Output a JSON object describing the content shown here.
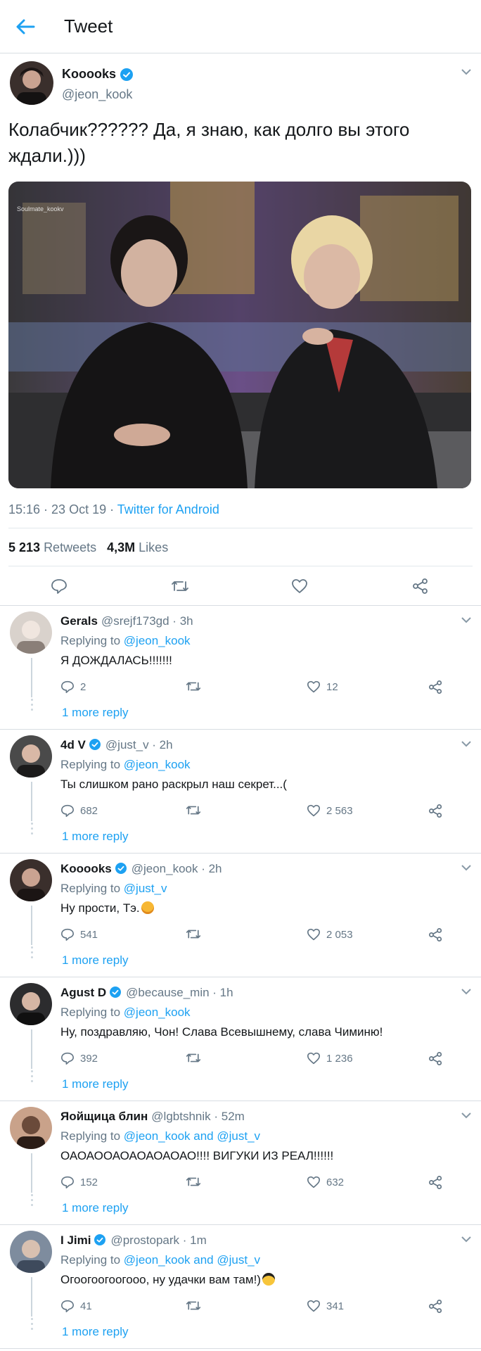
{
  "header": {
    "title": "Tweet"
  },
  "tweet": {
    "name": "Kooooks",
    "handle": "@jeon_kook",
    "text": "Колабчик?????? Да, я знаю, как долго вы этого ждали.)))",
    "timestamp": "15:16 · 23 Oct 19 · ",
    "source": "Twitter for Android",
    "retweets_count": "5 213",
    "retweets_label": "Retweets",
    "likes_count": "4,3M",
    "likes_label": "Likes"
  },
  "replies": [
    {
      "name": "Gerals",
      "verified": false,
      "handle": "@srejf173gd · 3h",
      "replying_prefix": "Replying to ",
      "replying_to": "@jeon_kook",
      "text": "Я ДОЖДАЛАСЬ!!!!!!!",
      "replies": "2",
      "retweets": "",
      "likes": "12",
      "more": "1 more reply"
    },
    {
      "name": "4d V",
      "verified": true,
      "handle": "@just_v · 2h",
      "replying_prefix": "Replying to ",
      "replying_to": "@jeon_kook",
      "text": "Ты слишком рано раскрыл наш секрет...(",
      "replies": "682",
      "retweets": "",
      "likes": "2 563",
      "more": "1 more reply"
    },
    {
      "name": "Kooooks",
      "verified": true,
      "handle": "@jeon_kook · 2h",
      "replying_prefix": "Replying to ",
      "replying_to": "@just_v",
      "text": "Ну прости, Тэ.",
      "replies": "541",
      "retweets": "",
      "likes": "2 053",
      "more": "1 more reply"
    },
    {
      "name": "Agust D",
      "verified": true,
      "handle": "@because_min · 1h",
      "replying_prefix": "Replying to ",
      "replying_to": "@jeon_kook",
      "text": "Ну, поздравляю, Чон! Слава Всевышнему, слава Чиминю!",
      "replies": "392",
      "retweets": "",
      "likes": "1 236",
      "more": "1 more reply"
    },
    {
      "name": "Яойщица блин",
      "verified": false,
      "handle": "@lgbtshnik · 52m",
      "replying_prefix": "Replying to ",
      "replying_to": "@jeon_kook and @just_v",
      "text": "ОАОАООАОАОАОАОАО!!!! ВИГУКИ ИЗ РЕАЛ!!!!!!",
      "replies": "152",
      "retweets": "",
      "likes": "632",
      "more": "1 more reply"
    },
    {
      "name": "I Jimi",
      "verified": true,
      "handle": "@prostopark · 1m",
      "replying_prefix": "Replying to ",
      "replying_to": "@jeon_kook and @just_v",
      "text": "Огоогоогоогооо, ну удачки вам там!)",
      "replies": "41",
      "retweets": "",
      "likes": "341",
      "more": "1 more reply"
    }
  ],
  "icons": {
    "back": "arrow-left-icon",
    "verified": "verified-badge-icon",
    "reply": "comment-bubble-icon",
    "retweet": "retweet-icon",
    "like": "heart-icon",
    "share": "share-icon",
    "caret": "chevron-down-icon"
  },
  "colors": {
    "accent": "#1da1f2",
    "secondary_text": "#657786",
    "primary_text": "#14171a",
    "divider": "#d8dde2"
  }
}
